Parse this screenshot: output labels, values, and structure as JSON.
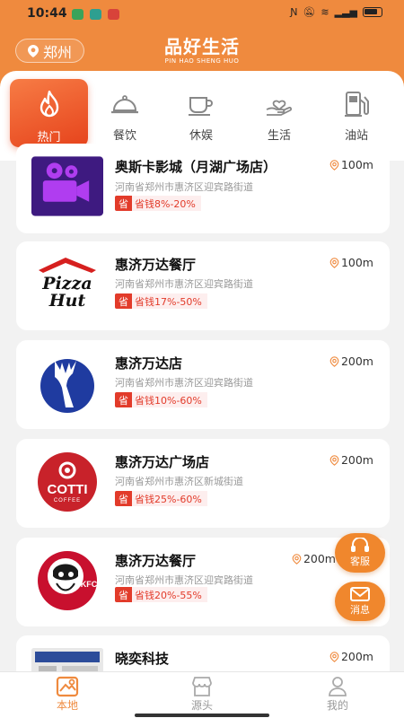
{
  "status_bar": {
    "time": "10:44",
    "battery": "100"
  },
  "header": {
    "location": "郑州",
    "brand_cn": "品好生活",
    "brand_en": "PIN HAO SHENG HUO"
  },
  "categories": [
    {
      "label": "热门",
      "icon": "fire-icon",
      "active": true
    },
    {
      "label": "餐饮",
      "icon": "dining-cloche-icon"
    },
    {
      "label": "休娱",
      "icon": "coffee-cup-icon"
    },
    {
      "label": "生活",
      "icon": "hand-heart-icon"
    },
    {
      "label": "油站",
      "icon": "gas-pump-icon"
    }
  ],
  "stores": [
    {
      "name": "奥斯卡影城（月湖广场店）",
      "distance": "100m",
      "address": "河南省郑州市惠济区迎宾路街道",
      "save_badge": "省",
      "discount": "省钱8%-20%",
      "logo": "movie-camera-logo"
    },
    {
      "name": "惠济万达餐厅",
      "distance": "100m",
      "address": "河南省郑州市惠济区迎宾路街道",
      "save_badge": "省",
      "discount": "省钱17%-50%",
      "logo": "pizza-hut-logo",
      "logo_text": [
        "Pizza",
        "Hut"
      ]
    },
    {
      "name": "惠济万达店",
      "distance": "200m",
      "address": "河南省郑州市惠济区迎宾路街道",
      "save_badge": "省",
      "discount": "省钱10%-60%",
      "logo": "deer-logo"
    },
    {
      "name": "惠济万达广场店",
      "distance": "200m",
      "address": "河南省郑州市惠济区新城街道",
      "save_badge": "省",
      "discount": "省钱25%-60%",
      "logo": "cotti-coffee-logo",
      "logo_text": [
        "COTTI",
        "COFFEE"
      ]
    },
    {
      "name": "惠济万达餐厅",
      "distance": "200m",
      "address": "河南省郑州市惠济区迎宾路街道",
      "save_badge": "省",
      "discount": "省钱20%-55%",
      "logo": "kfc-logo",
      "logo_text": [
        "KFC"
      ]
    },
    {
      "name": "晓奕科技",
      "distance": "200m",
      "logo": "storefront-photo"
    }
  ],
  "float_buttons": {
    "service": "客服",
    "message": "消息"
  },
  "tabs": [
    {
      "label": "本地",
      "icon": "map-icon",
      "active": true
    },
    {
      "label": "源头",
      "icon": "shop-icon"
    },
    {
      "label": "我的",
      "icon": "person-icon"
    }
  ],
  "colors": {
    "accent": "#ef8a3e",
    "discount_red": "#e23b2a"
  }
}
